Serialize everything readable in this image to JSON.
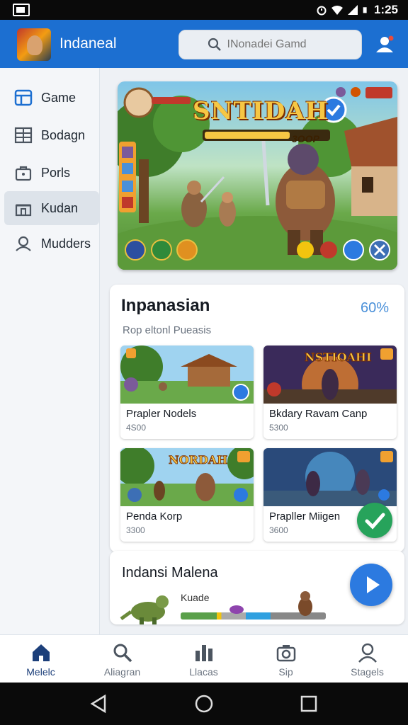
{
  "status_bar": {
    "time": "1:25"
  },
  "app": {
    "title": "Indaneal"
  },
  "search": {
    "placeholder": "INonadei Gamd"
  },
  "sidebar": {
    "items": [
      {
        "label": "Game",
        "icon": "grid-icon"
      },
      {
        "label": "Bodagn",
        "icon": "table-icon"
      },
      {
        "label": "Porls",
        "icon": "bag-icon"
      },
      {
        "label": "Kudan",
        "icon": "store-icon"
      },
      {
        "label": "Mudders",
        "icon": "people-icon"
      }
    ],
    "active_index": 3
  },
  "banner": {
    "title": "SNTIDAH",
    "score": "3OOP"
  },
  "section": {
    "title": "Inpanasian",
    "percent": "60%",
    "subtitle": "Rop eltonl Pueasis",
    "games": [
      {
        "name": "Prapler Nodels",
        "count": "4S00"
      },
      {
        "name": "Bkdary Ravam Canp",
        "count": "5300",
        "thumb_text": "NSTIOAHI"
      },
      {
        "name": "Penda Korp",
        "count": "3300",
        "thumb_text": "NORDAH"
      },
      {
        "name": "Prapller Miigen",
        "count": "3600"
      }
    ]
  },
  "promo": {
    "title": "Indansi Malena",
    "label": "Kuade"
  },
  "bottom_nav": {
    "items": [
      {
        "label": "Melelc",
        "icon": "home-icon"
      },
      {
        "label": "Aliagran",
        "icon": "search-icon"
      },
      {
        "label": "Llacas",
        "icon": "stats-icon"
      },
      {
        "label": "Sip",
        "icon": "camera-icon"
      },
      {
        "label": "Stagels",
        "icon": "profile-icon"
      }
    ],
    "active_index": 0
  },
  "colors": {
    "accent": "#1c6fd1",
    "active_nav": "#1c3f7a",
    "percent": "#4a90d9",
    "success": "#27a35b"
  }
}
